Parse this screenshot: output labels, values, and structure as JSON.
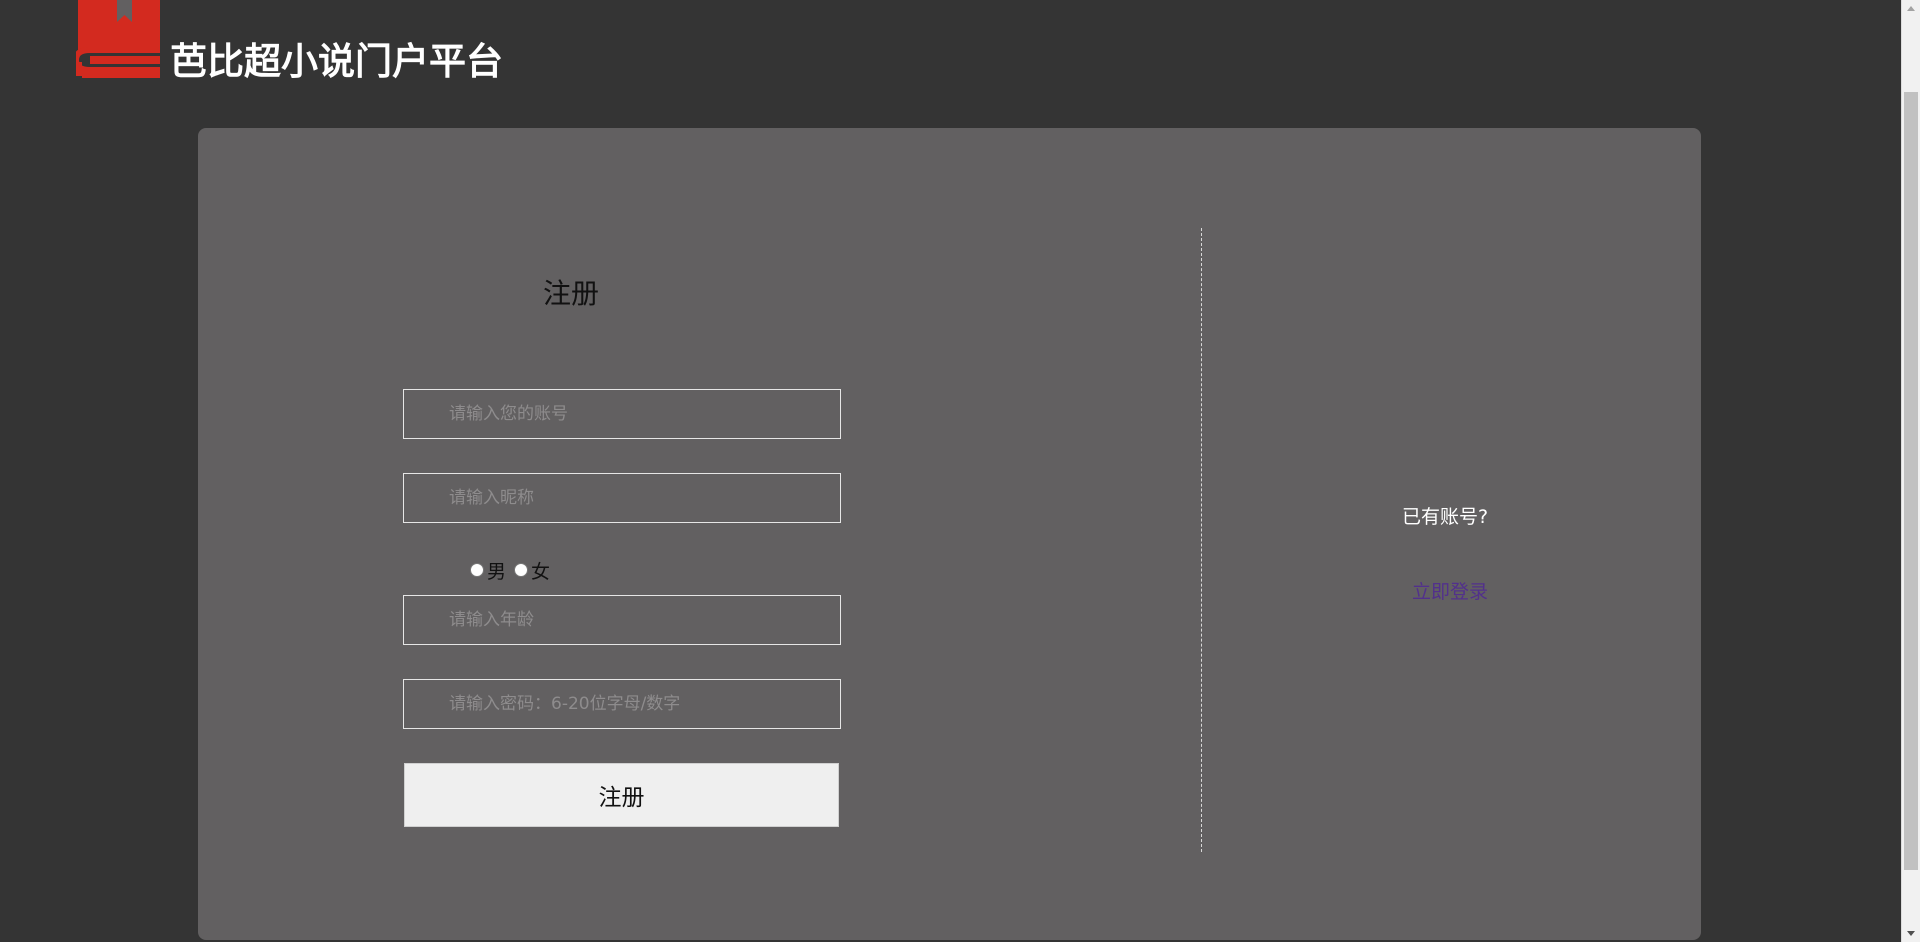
{
  "header": {
    "site_title": "芭比超小说门户平台",
    "logo_icon": "book-bookmark-icon"
  },
  "register_form": {
    "title": "注册",
    "account_placeholder": "请输入您的账号",
    "nickname_placeholder": "请输入昵称",
    "gender": {
      "male_label": "男",
      "female_label": "女",
      "selected": null
    },
    "age_placeholder": "请输入年龄",
    "password_placeholder": "请输入密码：6-20位字母/数字",
    "submit_label": "注册"
  },
  "login_side": {
    "prompt": "已有账号?",
    "login_link": "立即登录"
  },
  "colors": {
    "page_background": "#343434",
    "panel_background": "#626061",
    "logo_red": "#d32a1f",
    "link_color": "#52308c"
  }
}
